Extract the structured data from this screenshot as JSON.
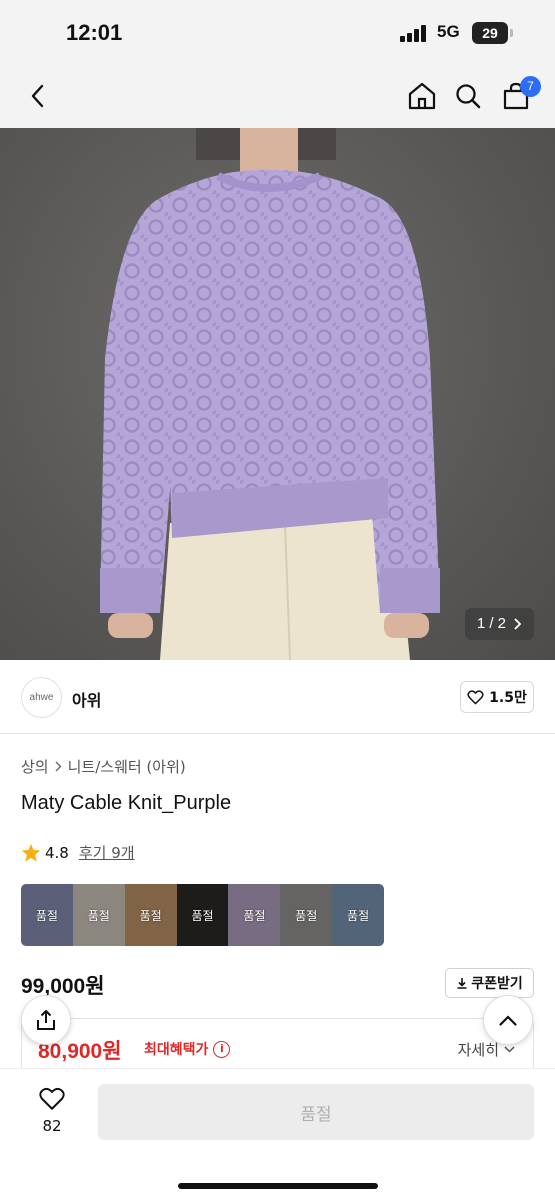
{
  "status": {
    "time": "12:01",
    "network": "5G",
    "battery": "29"
  },
  "nav": {
    "cart_count": "7"
  },
  "gallery": {
    "counter": "1 / 2"
  },
  "brand": {
    "logo_text": "ahwe",
    "name": "아위",
    "likes": "1.5만"
  },
  "product": {
    "breadcrumb": [
      "상의",
      "니트/스웨터 (아위)"
    ],
    "title": "Maty Cable Knit_Purple",
    "rating": "4.8",
    "reviews": "후기 9개",
    "swatches": [
      {
        "label": "품절",
        "color": "#8c93b8"
      },
      {
        "label": "품절",
        "color": "#d8cfc2"
      },
      {
        "label": "품절",
        "color": "#c79a6a"
      },
      {
        "label": "품절",
        "color": "#2e2b2a"
      },
      {
        "label": "품절",
        "color": "#b7a7c6"
      },
      {
        "label": "품절",
        "color": "#9b9a98"
      },
      {
        "label": "품절",
        "color": "#7f9bb8"
      }
    ],
    "price": "99,000원",
    "coupon": "쿠폰받기",
    "sale_price": "80,900원",
    "max_benefit": "최대혜택가",
    "detail": "자세히"
  },
  "bottom": {
    "wish_count": "82",
    "buy_label": "품절"
  },
  "colors": {
    "accent_red": "#e02828",
    "badge_blue": "#2d6cf4",
    "sweater": "#b6a6d8"
  }
}
